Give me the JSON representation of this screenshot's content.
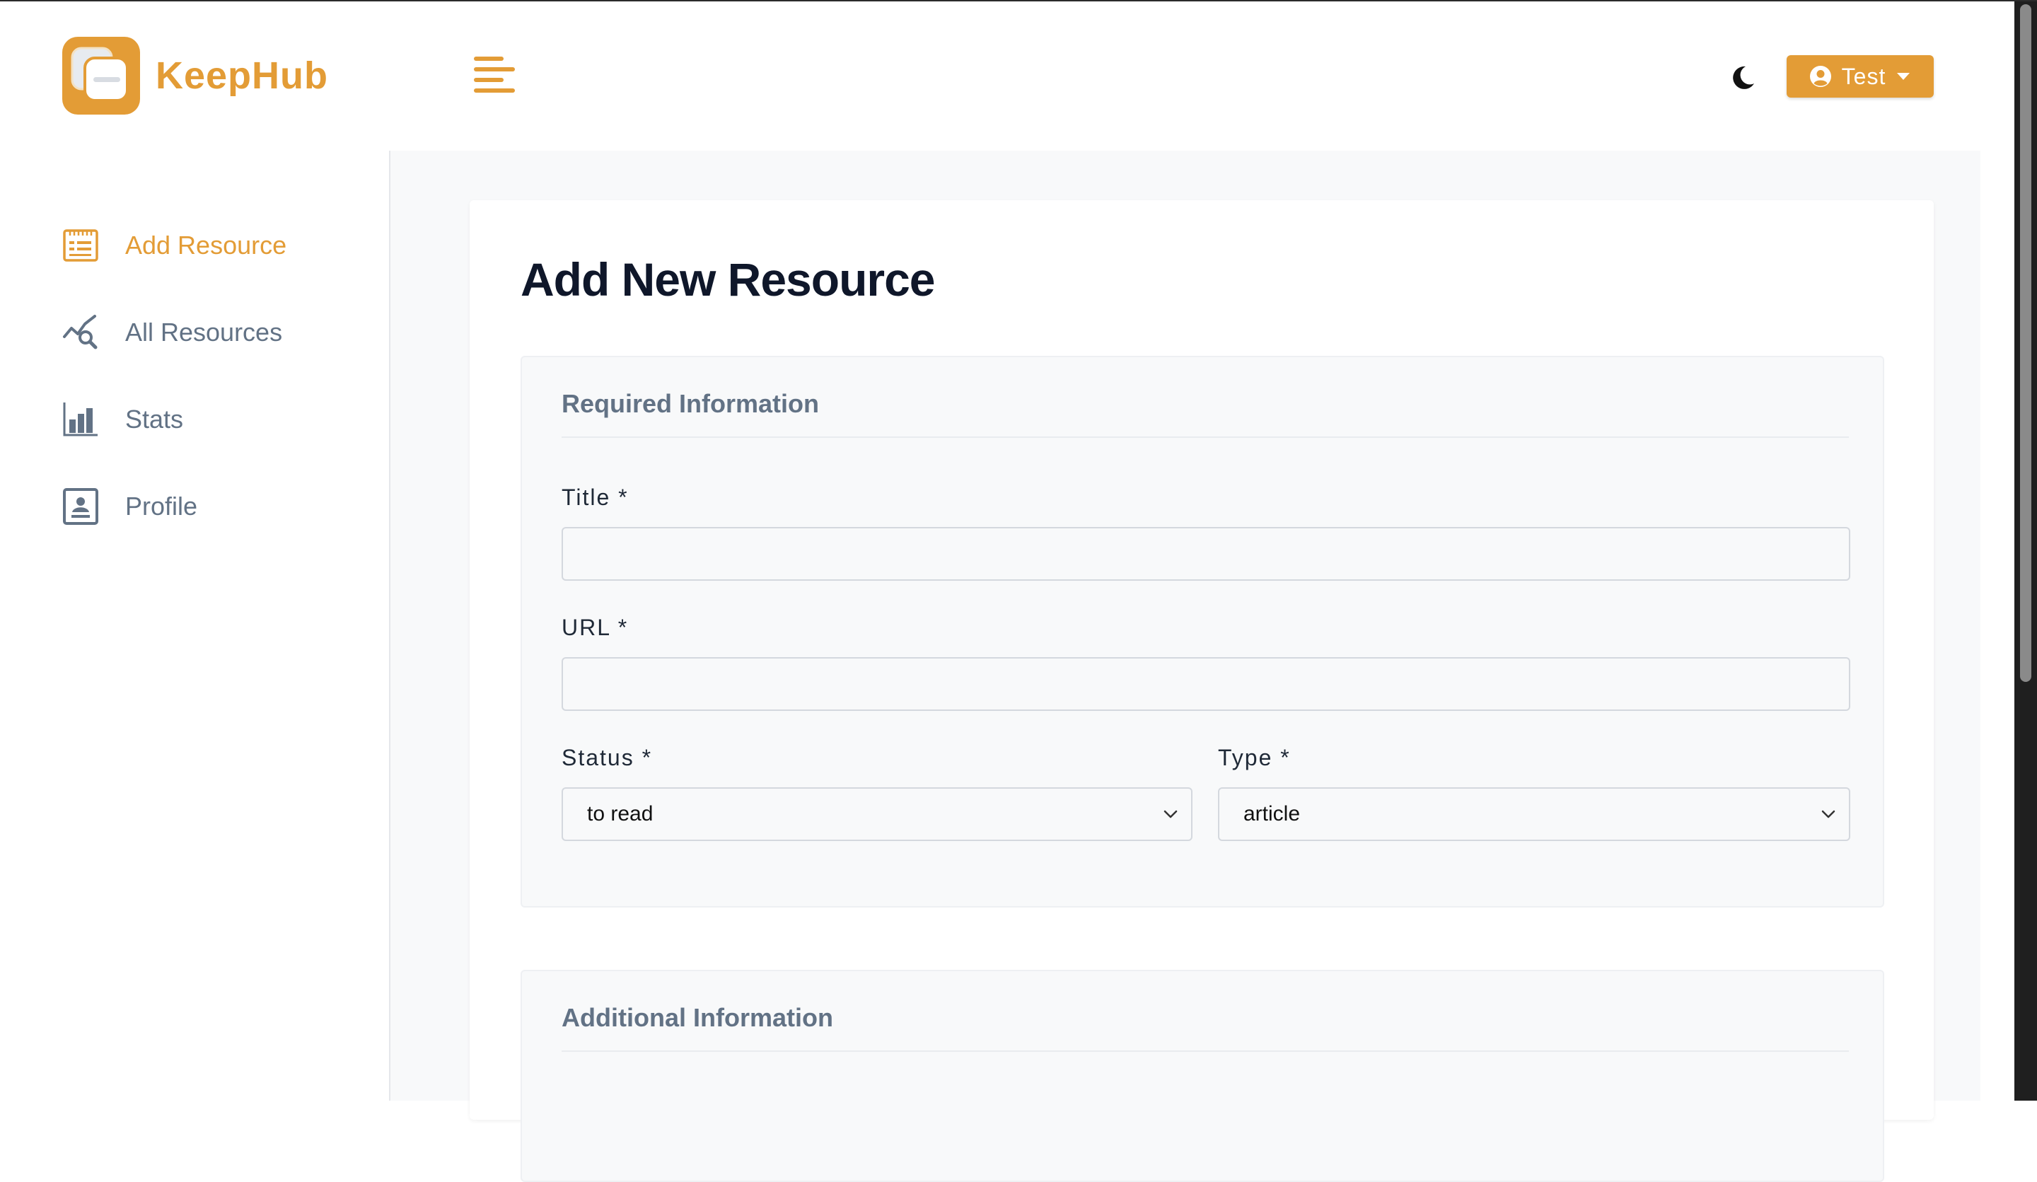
{
  "app": {
    "brand": "KeepHub",
    "accent_color": "#e39c36",
    "user_menu_label": "Test"
  },
  "header": {
    "menu_toggle_icon": "hamburger-menu-icon",
    "theme_toggle_icon": "moon-icon",
    "user_icon": "user-circle-icon",
    "user_dropdown_icon": "caret-down-icon"
  },
  "sidebar": {
    "items": [
      {
        "label": "Add Resource",
        "icon": "form-icon",
        "active": true
      },
      {
        "label": "All Resources",
        "icon": "chart-search-icon",
        "active": false
      },
      {
        "label": "Stats",
        "icon": "bar-chart-icon",
        "active": false
      },
      {
        "label": "Profile",
        "icon": "profile-card-icon",
        "active": false
      }
    ]
  },
  "main": {
    "page_title": "Add New Resource",
    "required_section": {
      "title": "Required Information",
      "title_label": "Title *",
      "title_value": "",
      "url_label": "URL *",
      "url_value": "",
      "status_label": "Status *",
      "status_value": "to read",
      "type_label": "Type *",
      "type_value": "article"
    },
    "additional_section": {
      "title": "Additional Information"
    }
  }
}
